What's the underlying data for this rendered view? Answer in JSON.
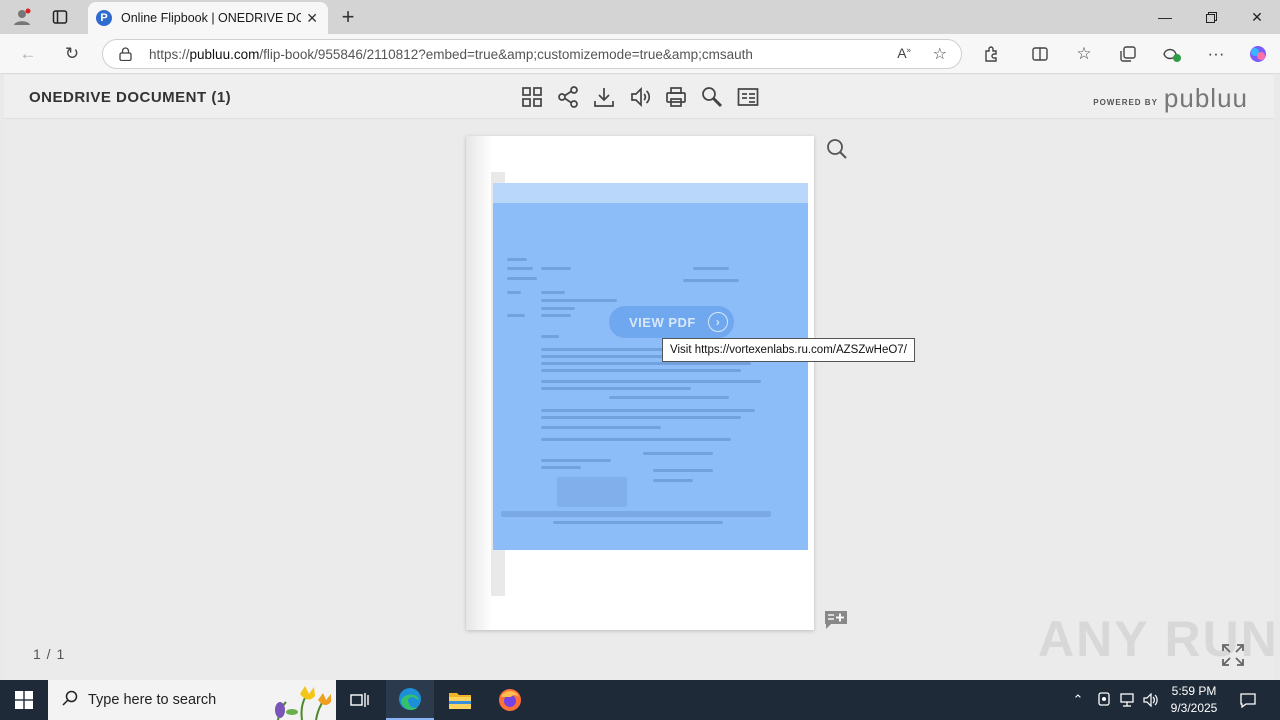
{
  "browser": {
    "tab_title": "Online Flipbook | ONEDRIVE DOCUMENT (1)",
    "tab_favicon_letter": "P",
    "url_prefix": "https://",
    "url_domain": "publuu.com",
    "url_path": "/flip-book/955846/2110812?embed=true&amp;customizemode=true&amp;cmsauth"
  },
  "app": {
    "document_title": "ONEDRIVE DOCUMENT (1)",
    "powered_by": "POWERED BY",
    "logo": "publuu",
    "view_pdf_label": "VIEW PDF",
    "tooltip": "Visit https://vortexenlabs.ru.com/AZSZwHeO7/",
    "pager": "1 / 1",
    "watermark": "ANY RUN",
    "tools": [
      "thumbnails-icon",
      "share-icon",
      "download-icon",
      "sound-icon",
      "print-icon",
      "search-icon",
      "table-of-contents-icon"
    ]
  },
  "taskbar": {
    "search_placeholder": "Type here to search",
    "time": "5:59 PM",
    "date": "9/3/2025"
  },
  "colors": {
    "overlay_blue": "#8dbdf9",
    "button_blue": "#6fa8ee",
    "taskbar": "#1f2a38"
  }
}
